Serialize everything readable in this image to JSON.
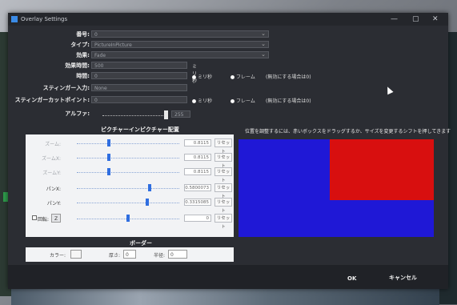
{
  "window": {
    "title": "Overlay Settings",
    "controls": [
      "—",
      "▢",
      "✕"
    ]
  },
  "form": {
    "number": {
      "label": "番号:",
      "value": "0"
    },
    "type": {
      "label": "タイプ:",
      "value": "PictureInPicture"
    },
    "effect": {
      "label": "効果:",
      "value": "Fade"
    },
    "effect_time": {
      "label": "効果時間:",
      "value": "500",
      "unit": "ミリ秒"
    },
    "time": {
      "label": "時間:",
      "value": "0",
      "opt_ms": "ミリ秒",
      "opt_frame": "フレーム",
      "note": "(無効にする場合は0)"
    },
    "stinger_input": {
      "label": "スティンガー入力:",
      "value": "None"
    },
    "stinger_cut": {
      "label": "スティンガーカットポイント:",
      "value": "0",
      "opt_ms": "ミリ秒",
      "opt_frame": "フレーム",
      "note": "(無効にする場合は0)"
    },
    "alpha": {
      "label": "アルファ:",
      "value": "255"
    }
  },
  "pip": {
    "heading": "ピクチャーインピクチャー配置",
    "rows": [
      {
        "label": "ズーム:",
        "value": "0.8115",
        "reset": "リセット",
        "level": 0.31
      },
      {
        "label": "ズームX:",
        "value": "0.8115",
        "reset": "リセット",
        "level": 0.31
      },
      {
        "label": "ズームY:",
        "value": "0.8115",
        "reset": "リセット",
        "level": 0.31
      },
      {
        "label": "パンX:",
        "value": "0.5800073",
        "reset": "リセット",
        "level": 0.72
      },
      {
        "label": "パンY:",
        "value": "0.3315085",
        "reset": "リセット",
        "level": 0.69
      },
      {
        "label": "回転:",
        "value": "0",
        "reset": "リセット",
        "level": 0.5
      }
    ],
    "rotation_toggle": "Z"
  },
  "preview": {
    "hint": "位置を調整するには、赤いボックスをドラッグするか、サイズを変更するシフトを押してきます",
    "colors": {
      "background": "#1f18d6",
      "pip": "#d80f0f"
    }
  },
  "border": {
    "heading": "ボーダー",
    "color_label": "カラー:",
    "thickness_label": "厚さ:",
    "thickness_value": "0",
    "radius_label": "半径:",
    "radius_value": "0"
  },
  "buttons": {
    "ok": "OK",
    "cancel": "キャンセル"
  }
}
